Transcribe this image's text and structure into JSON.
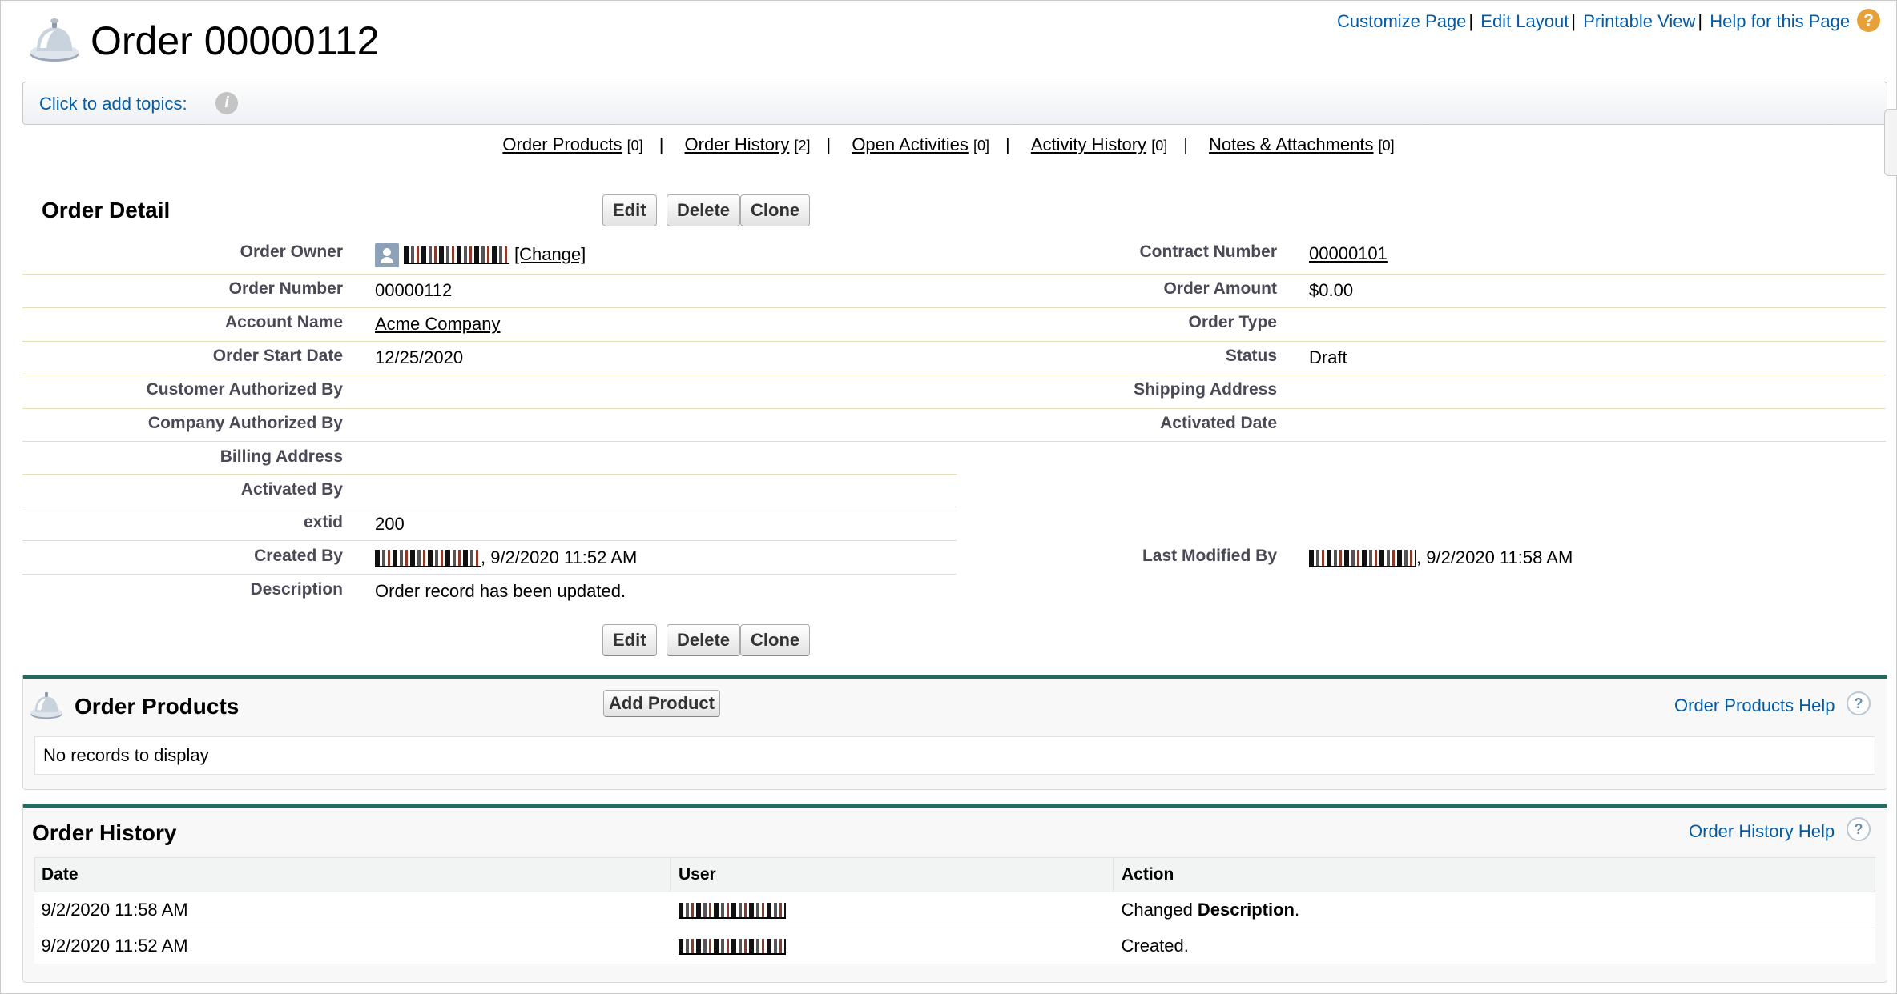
{
  "header": {
    "title": "Order 00000112",
    "links": [
      "Customize Page",
      "Edit Layout",
      "Printable View",
      "Help for this Page"
    ],
    "help_icon": "?"
  },
  "topics": {
    "label": "Click to add topics:",
    "info_icon": "i"
  },
  "related_nav": [
    {
      "label": "Order Products",
      "count": "[0]"
    },
    {
      "label": "Order History",
      "count": "[2]"
    },
    {
      "label": "Open Activities",
      "count": "[0]"
    },
    {
      "label": "Activity History",
      "count": "[0]"
    },
    {
      "label": "Notes & Attachments",
      "count": "[0]"
    }
  ],
  "detail": {
    "title": "Order Detail",
    "buttons": {
      "edit": "Edit",
      "delete": "Delete",
      "clone": "Clone"
    },
    "left": {
      "order_owner": {
        "label": "Order Owner",
        "change": "[Change]"
      },
      "order_number": {
        "label": "Order Number",
        "value": "00000112"
      },
      "account_name": {
        "label": "Account Name",
        "value": "Acme Company"
      },
      "order_start_date": {
        "label": "Order Start Date",
        "value": "12/25/2020"
      },
      "customer_authorized_by": {
        "label": "Customer Authorized By",
        "value": ""
      },
      "company_authorized_by": {
        "label": "Company Authorized By",
        "value": ""
      },
      "billing_address": {
        "label": "Billing Address",
        "value": ""
      },
      "activated_by": {
        "label": "Activated By",
        "value": ""
      },
      "extid": {
        "label": "extid",
        "value": "200"
      },
      "created_by": {
        "label": "Created By",
        "value": ", 9/2/2020 11:52 AM"
      },
      "description": {
        "label": "Description",
        "value": "Order record has been updated."
      }
    },
    "right": {
      "contract_number": {
        "label": "Contract Number",
        "value": "00000101"
      },
      "order_amount": {
        "label": "Order Amount",
        "value": "$0.00"
      },
      "order_type": {
        "label": "Order Type",
        "value": ""
      },
      "status": {
        "label": "Status",
        "value": "Draft"
      },
      "shipping_address": {
        "label": "Shipping Address",
        "value": ""
      },
      "activated_date": {
        "label": "Activated Date",
        "value": ""
      },
      "last_modified_by": {
        "label": "Last Modified By",
        "value": ", 9/2/2020 11:58 AM"
      }
    }
  },
  "order_products": {
    "title": "Order Products",
    "add_button": "Add Product",
    "help": "Order Products Help",
    "empty": "No records to display"
  },
  "order_history": {
    "title": "Order History",
    "help": "Order History Help",
    "columns": [
      "Date",
      "User",
      "Action"
    ],
    "rows": [
      {
        "date": "9/2/2020 11:58 AM",
        "action_prefix": "Changed ",
        "action_bold": "Description",
        "action_suffix": "."
      },
      {
        "date": "9/2/2020 11:52 AM",
        "action_prefix": "Created.",
        "action_bold": "",
        "action_suffix": ""
      }
    ]
  },
  "colors": {
    "link": "#015ba7",
    "section_border": "#236b5e",
    "help_orange": "#e6a13b"
  }
}
